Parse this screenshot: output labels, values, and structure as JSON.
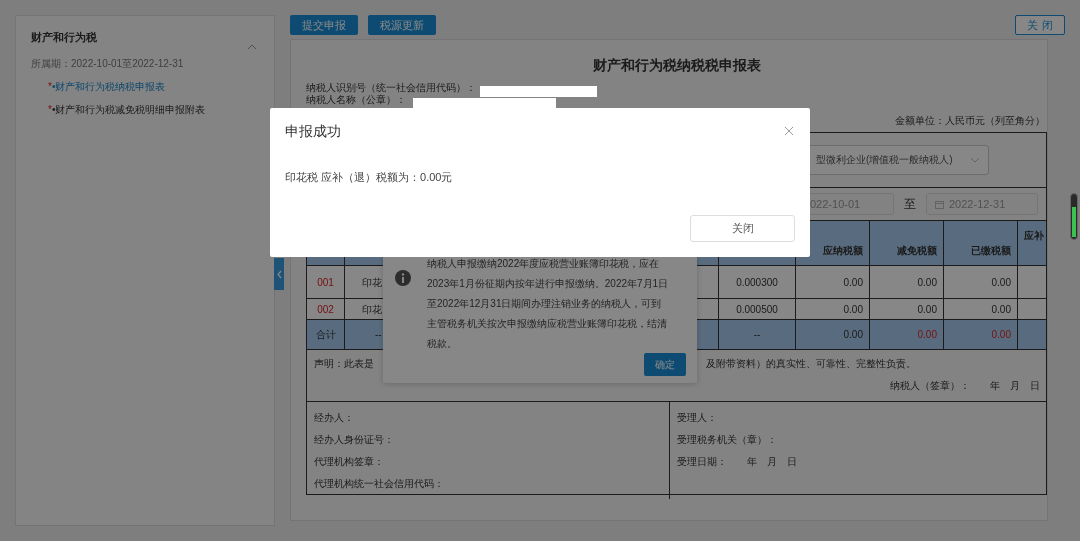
{
  "sidebar": {
    "title": "财产和行为税",
    "period": "所属期：2022-10-01至2022-12-31",
    "expanded": true,
    "items": [
      {
        "mark": "*",
        "label": "•财产和行为税纳税申报表",
        "selected": true
      },
      {
        "mark": "*",
        "label": "•财产和行为税减免税明细申报附表",
        "selected": false
      }
    ]
  },
  "toolbar": {
    "buttons": [
      "提交申报",
      "税源更新"
    ],
    "close": "关 闭"
  },
  "form": {
    "title": "财产和行为税纳税税申报表",
    "taxpayer_id_label": "纳税人识别号（统一社会信用代码）：",
    "taxpayer_name_label": "纳税人名称（公章）：",
    "unit": "金额单位：人民币元（列至角分）",
    "taxpayer_type": "型微利企业(增值税一般纳税人)",
    "period_from": "022-10-01",
    "period_separator": "至",
    "period_to": "2022-12-31",
    "table": {
      "columns": [
        "应纳税额",
        "减免税额",
        "已缴税额",
        "应补"
      ],
      "rows": [
        {
          "code": "001",
          "item": "印花",
          "rate": "0.000300",
          "payable": "0.00",
          "relief": "0.00",
          "paid": "0.00"
        },
        {
          "code": "002",
          "item": "印花",
          "rate": "0.000500",
          "payable": "0.00",
          "relief": "0.00",
          "paid": "0.00"
        }
      ],
      "total": {
        "label": "合计",
        "column_2": "--",
        "rate": "--",
        "values": [
          {
            "value": "0.00",
            "alert": false
          },
          {
            "value": "0.00",
            "alert": true
          },
          {
            "value": "0.00",
            "alert": true
          }
        ]
      }
    },
    "declaration_start": "声明：此表是",
    "declaration_end": "及附带资料）的真实性、可靠性、完整性负责。",
    "signature": "纳税人（签章）：　　年　月　日",
    "handler_fields": [
      "经办人：",
      "经办人身份证号：",
      "代理机构签章：",
      "代理机构统一社会信用代码："
    ],
    "acceptance_fields": [
      "受理人：",
      "受理税务机关（章）：",
      "受理日期：　　年　月　日"
    ]
  },
  "notice": {
    "lines": [
      "纳税人申报缴纳2022年度应税营业账簿印花税，应在",
      "2023年1月份征期内按年进行申报缴纳。2022年7月1日",
      "至2022年12月31日期间办理注销业务的纳税人，可到",
      "主管税务机关按次申报缴纳应税营业账簿印花税，结清",
      "税款。"
    ],
    "button": "确定"
  },
  "dialog": {
    "title": "申报成功",
    "message": "印花税 应补（退）税额为：0.00元",
    "button": "关闭"
  }
}
